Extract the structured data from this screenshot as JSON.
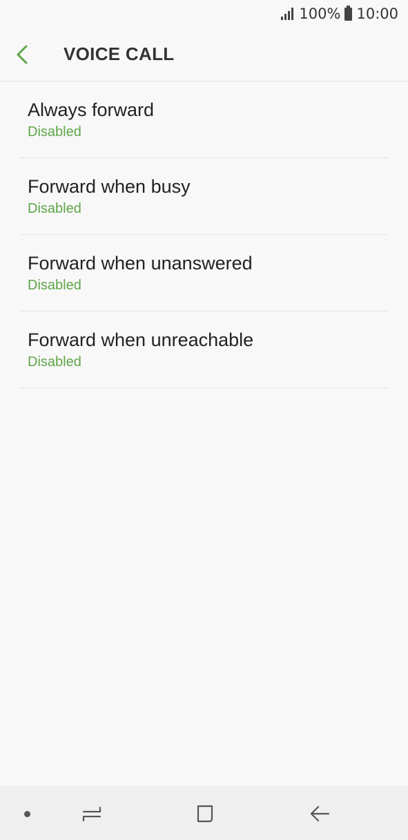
{
  "status_bar": {
    "battery_percent": "100%",
    "time": "10:00",
    "signal_icon": "signal-icon",
    "battery_icon": "battery-icon"
  },
  "header": {
    "title": "VOICE CALL",
    "back_icon": "chevron-left-icon",
    "accent_color": "#5fa548"
  },
  "items": [
    {
      "title": "Always forward",
      "status": "Disabled"
    },
    {
      "title": "Forward when busy",
      "status": "Disabled"
    },
    {
      "title": "Forward when unanswered",
      "status": "Disabled"
    },
    {
      "title": "Forward when unreachable",
      "status": "Disabled"
    }
  ],
  "nav_bar": {
    "buttons": [
      "dot-icon",
      "recents-icon",
      "home-icon",
      "back-icon"
    ]
  }
}
